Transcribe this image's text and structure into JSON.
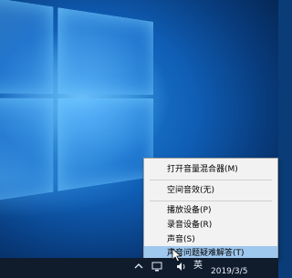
{
  "context_menu": {
    "items": [
      {
        "label": "打开音量混合器(M)"
      },
      {
        "label": "空间音效(无)"
      },
      {
        "label": "播放设备(P)"
      },
      {
        "label": "录音设备(R)"
      },
      {
        "label": "声音(S)"
      },
      {
        "label": "声音问题疑难解答(T)"
      }
    ],
    "highlight_color": "#9fc8ee"
  },
  "taskbar": {
    "tray_icons": [
      "chevron-up-icon",
      "network-icon",
      "volume-icon"
    ],
    "ime_label": "英",
    "date": "2019/3/5"
  },
  "colors": {
    "taskbar": "#101b2c",
    "menu_bg": "#f2f2f2",
    "desktop": "#1f86d8"
  }
}
